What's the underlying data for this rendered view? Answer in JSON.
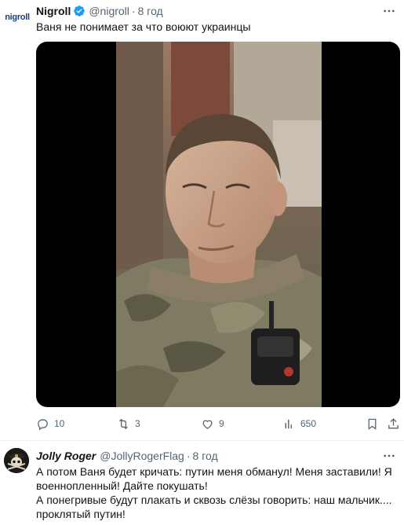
{
  "tweet1": {
    "avatar_brand": "nigroll",
    "name": "Nigroll",
    "handle": "@nigroll",
    "separator": "·",
    "time": "8 год",
    "text": "Ваня не понимает за что воюют украинцы",
    "stats": {
      "replies": "10",
      "retweets": "3",
      "likes": "9",
      "views": "650"
    }
  },
  "tweet2": {
    "name": "Jolly Roger",
    "handle": "@JollyRogerFlag",
    "separator": "·",
    "time": "8 год",
    "lines": [
      "А потом Ваня будет кричать: путин меня обманул! Меня заставили! Я военнопленный! Дайте покушать!",
      "А понегривые будут плакать и сквозь слёзы говорить: наш мальчик.... проклятый путин!"
    ]
  },
  "colors": {
    "verified": "#1d9bf0",
    "muted": "#536471",
    "text": "#0f1419",
    "brand": "#1a3f78"
  },
  "icons": {
    "more": "more-icon",
    "verified": "verified-badge-icon",
    "reply": "reply-icon",
    "retweet": "retweet-icon",
    "like": "like-icon",
    "views": "views-icon",
    "bookmark": "bookmark-icon",
    "share": "share-icon"
  }
}
